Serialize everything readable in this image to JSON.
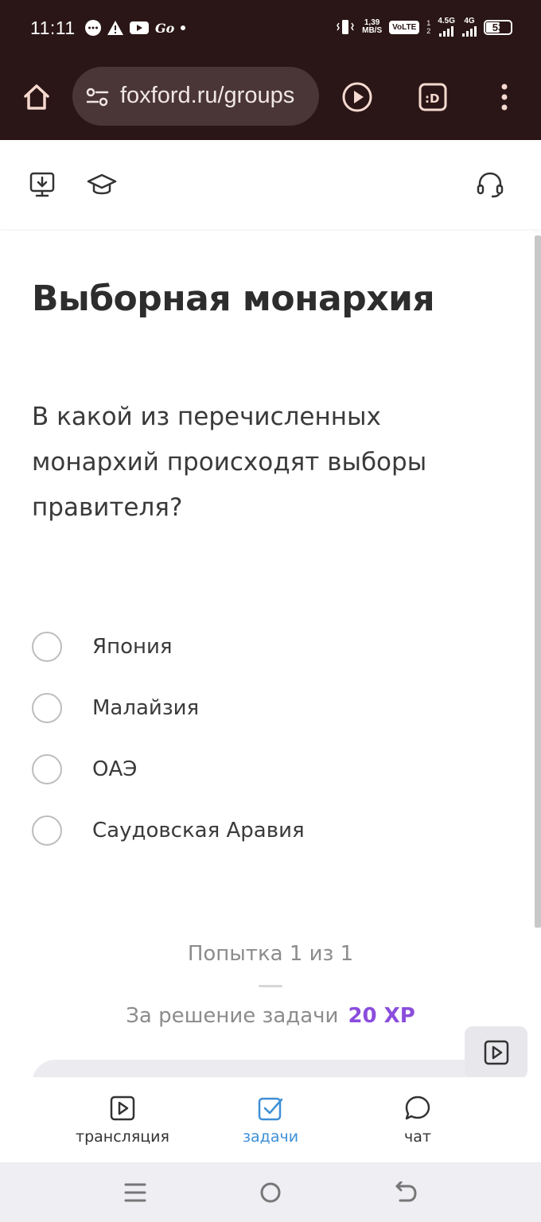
{
  "status_bar": {
    "time": "11:11",
    "network_speed": "1,39",
    "network_unit": "MB/S",
    "volte": "VoLTE",
    "sim1_label": "4.5G",
    "sim2_label": "4G",
    "battery": "53"
  },
  "browser": {
    "url": "foxford.ru/groups"
  },
  "page": {
    "title": "Выборная монархия",
    "question": "В какой из перечисленных монархий происходят выборы правителя?",
    "options": [
      {
        "label": "Япония"
      },
      {
        "label": "Малайзия"
      },
      {
        "label": "ОАЭ"
      },
      {
        "label": "Саудовская Аравия"
      }
    ],
    "attempt": "Попытка 1 из 1",
    "reward_label": "За решение задачи",
    "reward_value": "20 XP"
  },
  "bottom_nav": {
    "items": [
      {
        "label": "трансляция",
        "icon": "play-square-icon"
      },
      {
        "label": "задачи",
        "icon": "checkbox-icon",
        "active": true
      },
      {
        "label": "чат",
        "icon": "chat-bubble-icon"
      }
    ]
  },
  "colors": {
    "chrome_bg": "#2a1616",
    "accent_xp": "#8a4ddd",
    "active_nav": "#3e8fd6"
  }
}
